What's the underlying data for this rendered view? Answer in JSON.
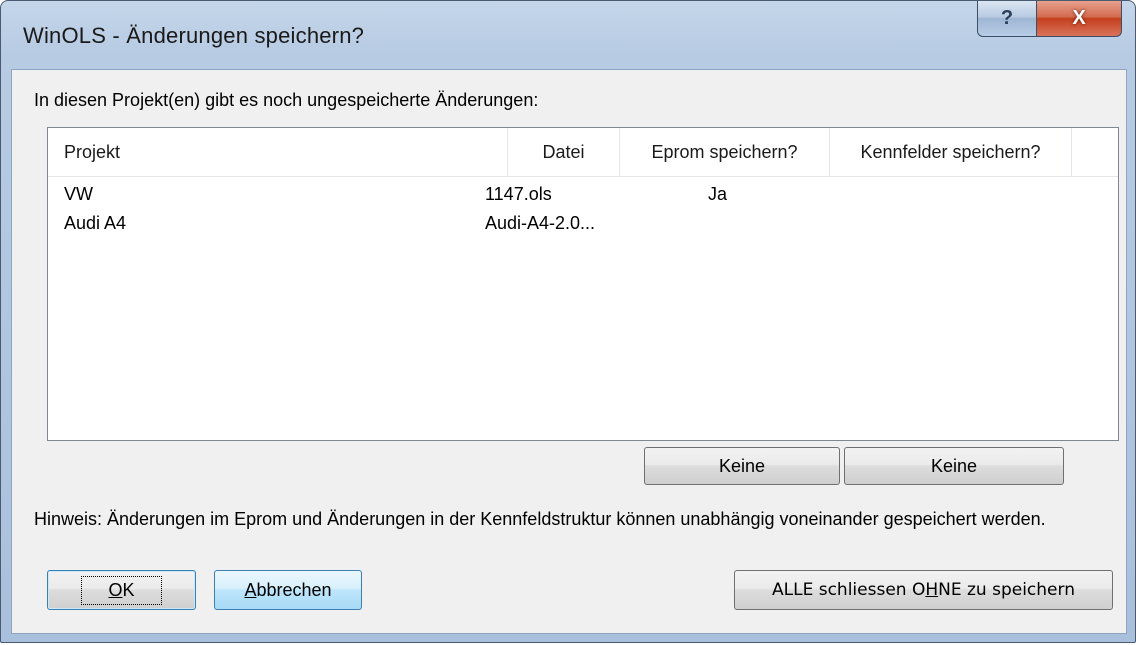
{
  "window": {
    "title": "WinOLS - Änderungen speichern?",
    "help_button": "?",
    "close_button": "X"
  },
  "intro": "In diesen Projekt(en) gibt es noch ungespeicherte Änderungen:",
  "table": {
    "columns": [
      "Projekt",
      "Datei",
      "Eprom speichern?",
      "Kennfelder speichern?"
    ],
    "rows": [
      {
        "projekt": "VW",
        "datei": "1147.ols",
        "eprom": "Ja",
        "kennfelder": ""
      },
      {
        "projekt": "Audi A4",
        "datei": "Audi-A4-2.0...",
        "eprom": "",
        "kennfelder": ""
      }
    ]
  },
  "buttons": {
    "keine_eprom": "Keine",
    "keine_kennfelder": "Keine",
    "ok_mnemonic": "O",
    "ok_rest": "K",
    "cancel_mnemonic": "A",
    "cancel_rest": "bbrechen",
    "close_all_pre": "ALLE schliessen O",
    "close_all_mnemonic": "H",
    "close_all_post": "NE zu speichern"
  },
  "note": "Hinweis: Änderungen im Eprom und Änderungen in der Kennfeldstruktur können unabhängig voneinander gespeichert werden."
}
